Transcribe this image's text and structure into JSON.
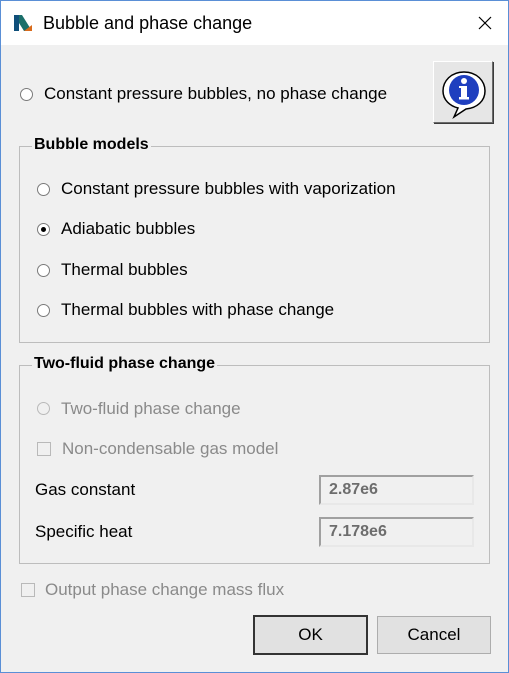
{
  "window": {
    "title": "Bubble and phase change"
  },
  "top_option": {
    "label": "Constant pressure bubbles, no phase change",
    "selected": false
  },
  "bubble_models": {
    "title": "Bubble models",
    "options": [
      {
        "label": "Constant pressure bubbles with vaporization",
        "selected": false
      },
      {
        "label": "Adiabatic bubbles",
        "selected": true
      },
      {
        "label": "Thermal bubbles",
        "selected": false
      },
      {
        "label": "Thermal bubbles with phase change",
        "selected": false
      }
    ]
  },
  "two_fluid": {
    "title": "Two-fluid phase change",
    "radio_label": "Two-fluid phase change",
    "checkbox_label": "Non-condensable gas model",
    "gas_constant_label": "Gas constant",
    "gas_constant_value": "2.87e6",
    "specific_heat_label": "Specific heat",
    "specific_heat_value": "7.178e6"
  },
  "output_checkbox": {
    "label": "Output phase change mass flux",
    "checked": false
  },
  "buttons": {
    "ok": "OK",
    "cancel": "Cancel"
  },
  "colors": {
    "window_border": "#5a8fd6",
    "dialog_bg": "#f0f0f0",
    "disabled_text": "#8a8a8a",
    "info_blue": "#1f3fbf"
  }
}
